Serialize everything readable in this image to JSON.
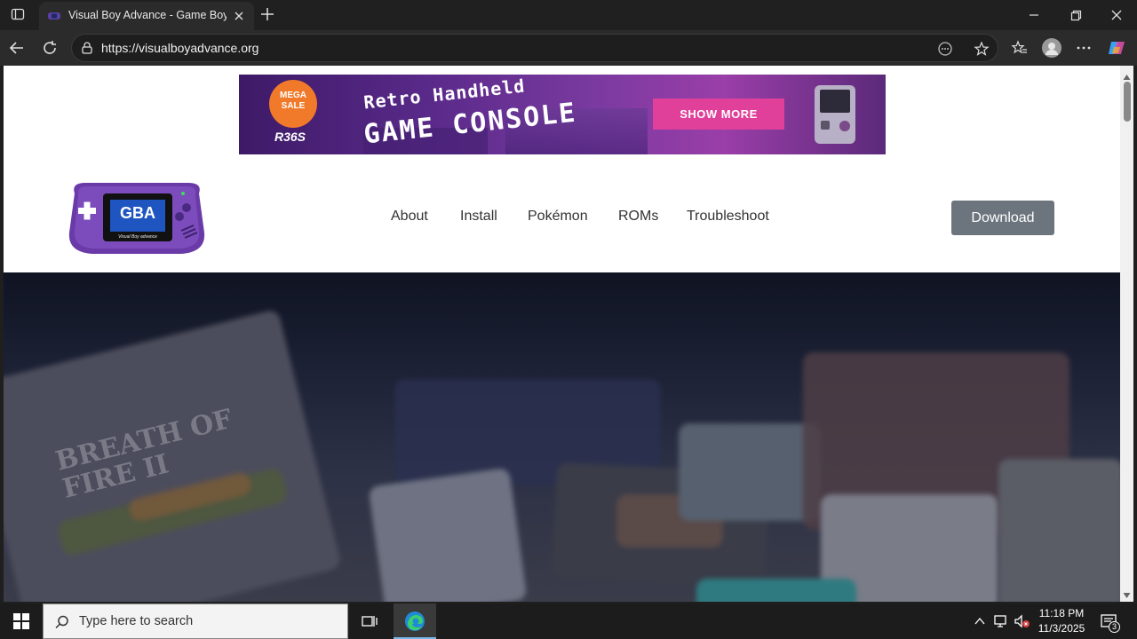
{
  "browser": {
    "tab_title": "Visual Boy Advance - Game Boy Advance",
    "url": "https://visualboyadvance.org"
  },
  "banner": {
    "badge": "MEGA SALE",
    "title_line1": "Retro Handheld",
    "title_line2": "GAME CONSOLE",
    "product": "R36S",
    "cta": "SHOW MORE"
  },
  "logo": {
    "screen_text": "GBA",
    "caption": "Visual Boy advance"
  },
  "nav": {
    "items": [
      "About",
      "Install",
      "Pokémon",
      "ROMs",
      "Troubleshoot"
    ],
    "download": "Download"
  },
  "hero": {
    "cartridge_title": "BREATH OF FIRE II"
  },
  "taskbar": {
    "search_placeholder": "Type here to search",
    "time": "11:18 PM",
    "date": "11/3/2025",
    "notifications": "3"
  },
  "colors": {
    "chrome_dark": "#202020",
    "nav_text": "#333333",
    "download_button": "#6c757d",
    "banner_pink": "#e0409a",
    "gba_purple": "#6a3aa8"
  }
}
